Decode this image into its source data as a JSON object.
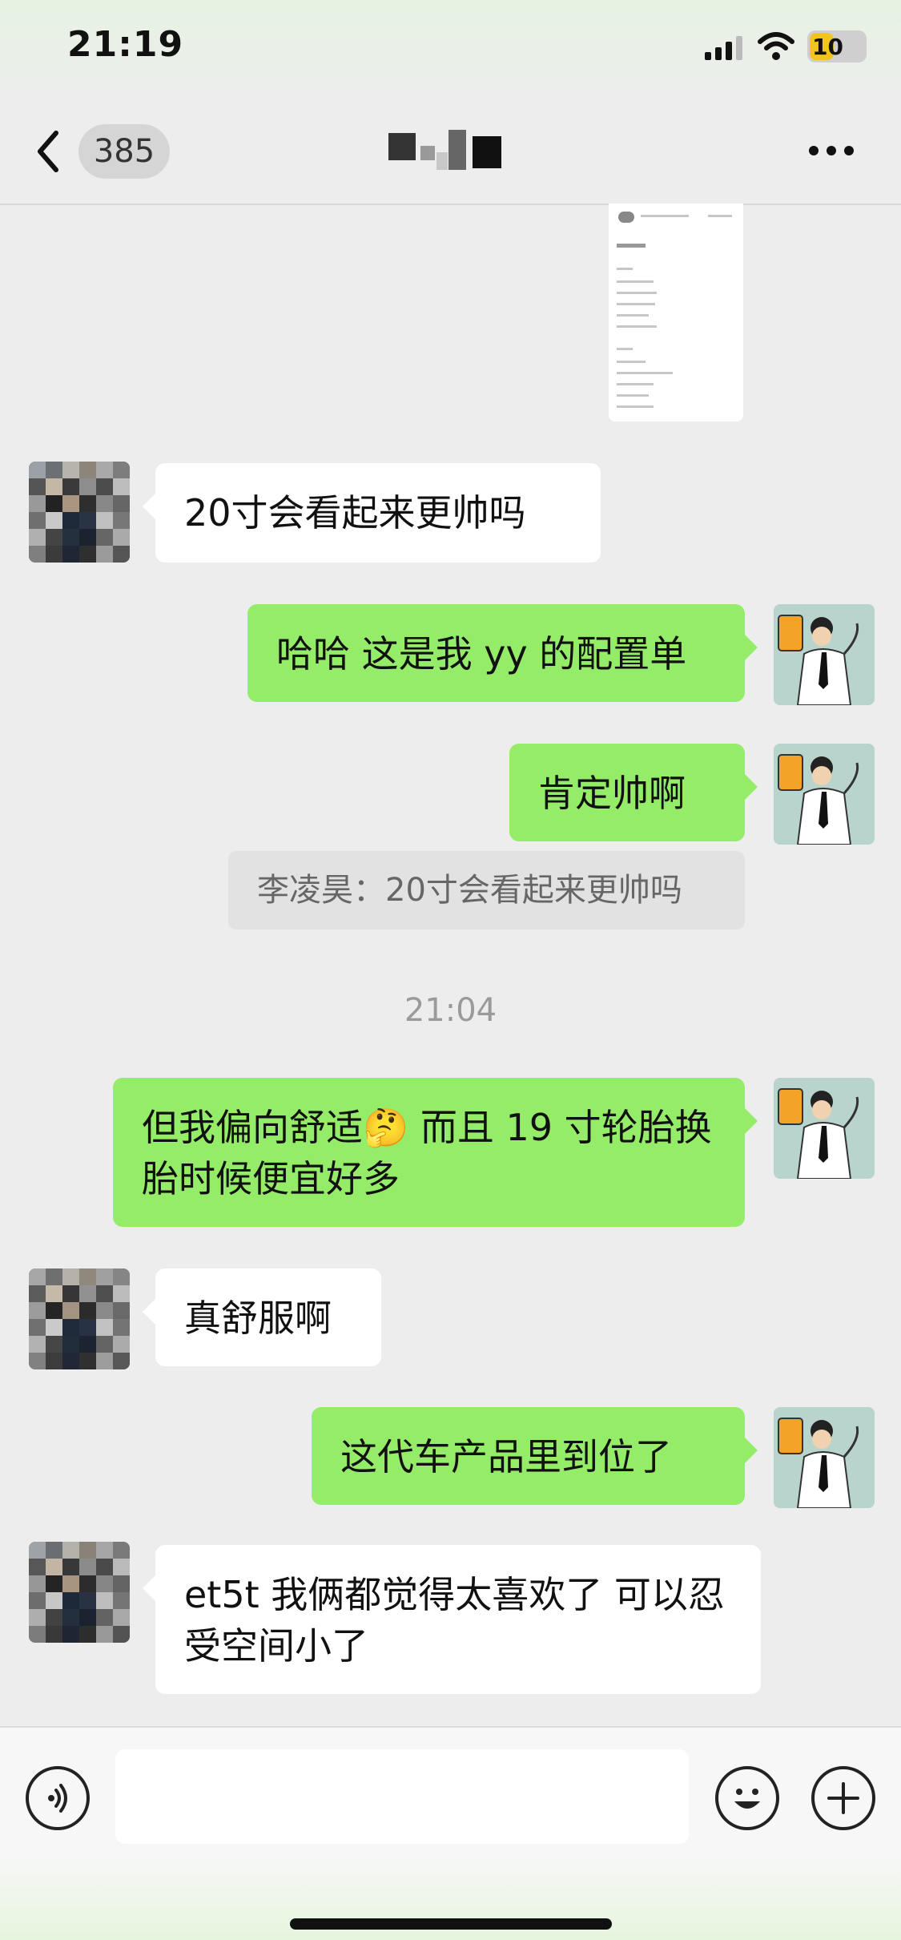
{
  "status_bar": {
    "time": "21:19",
    "battery": "10"
  },
  "nav": {
    "unread_count": "385",
    "title_redacted": true
  },
  "messages": [
    {
      "side": "left",
      "text": "20寸会看起来更帅吗"
    },
    {
      "side": "right",
      "text": "哈哈 这是我 yy 的配置单"
    },
    {
      "side": "right",
      "text": "肯定帅啊"
    },
    {
      "quote": "李凌昊：20寸会看起来更帅吗"
    },
    {
      "side": "right",
      "text_1": "但我偏向舒适",
      "emoji": "🤔",
      "text_2": " 而且 19 寸轮胎换胎时候便宜好多"
    },
    {
      "side": "left",
      "text": "真舒服啊"
    },
    {
      "side": "right",
      "text": "这代车产品里到位了"
    },
    {
      "side": "left",
      "text": "et5t 我俩都觉得太喜欢了 可以忍受空间小了"
    }
  ],
  "timestamp": "21:04",
  "colors": {
    "my_bubble": "#95ec69",
    "their_bubble": "#ffffff",
    "background": "#ededed"
  },
  "icons": [
    "back-chevron-icon",
    "more-icon",
    "signal-icon",
    "wifi-icon",
    "battery-icon",
    "voice-icon",
    "emoji-icon",
    "plus-icon"
  ]
}
